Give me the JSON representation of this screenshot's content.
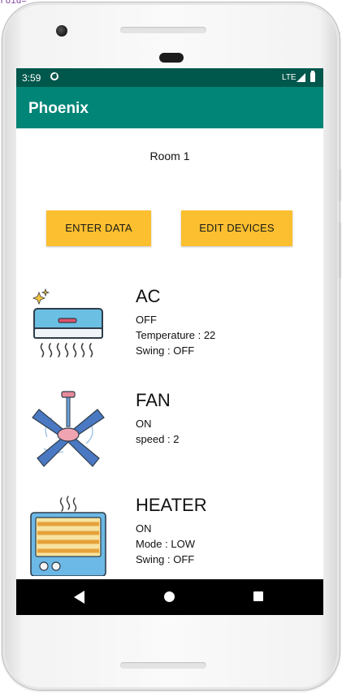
{
  "editor": {
    "code_snippet": "roid="
  },
  "status_bar": {
    "time": "3:59",
    "network": "LTE"
  },
  "app_bar": {
    "title": "Phoenix"
  },
  "room": {
    "title": "Room 1"
  },
  "buttons": {
    "enter_data": "ENTER DATA",
    "edit_devices": "EDIT DEVICES"
  },
  "devices": [
    {
      "name": "AC",
      "state": "OFF",
      "details": [
        "Temperature : 22",
        "Swing : OFF"
      ]
    },
    {
      "name": "FAN",
      "state": "ON",
      "details": [
        "speed : 2"
      ]
    },
    {
      "name": "HEATER",
      "state": "ON",
      "details": [
        "Mode : LOW",
        "Swing : OFF"
      ]
    }
  ],
  "colors": {
    "status_bar": "#00574b",
    "app_bar": "#008577",
    "button": "#fbbf2f",
    "nav_bar": "#000000"
  }
}
